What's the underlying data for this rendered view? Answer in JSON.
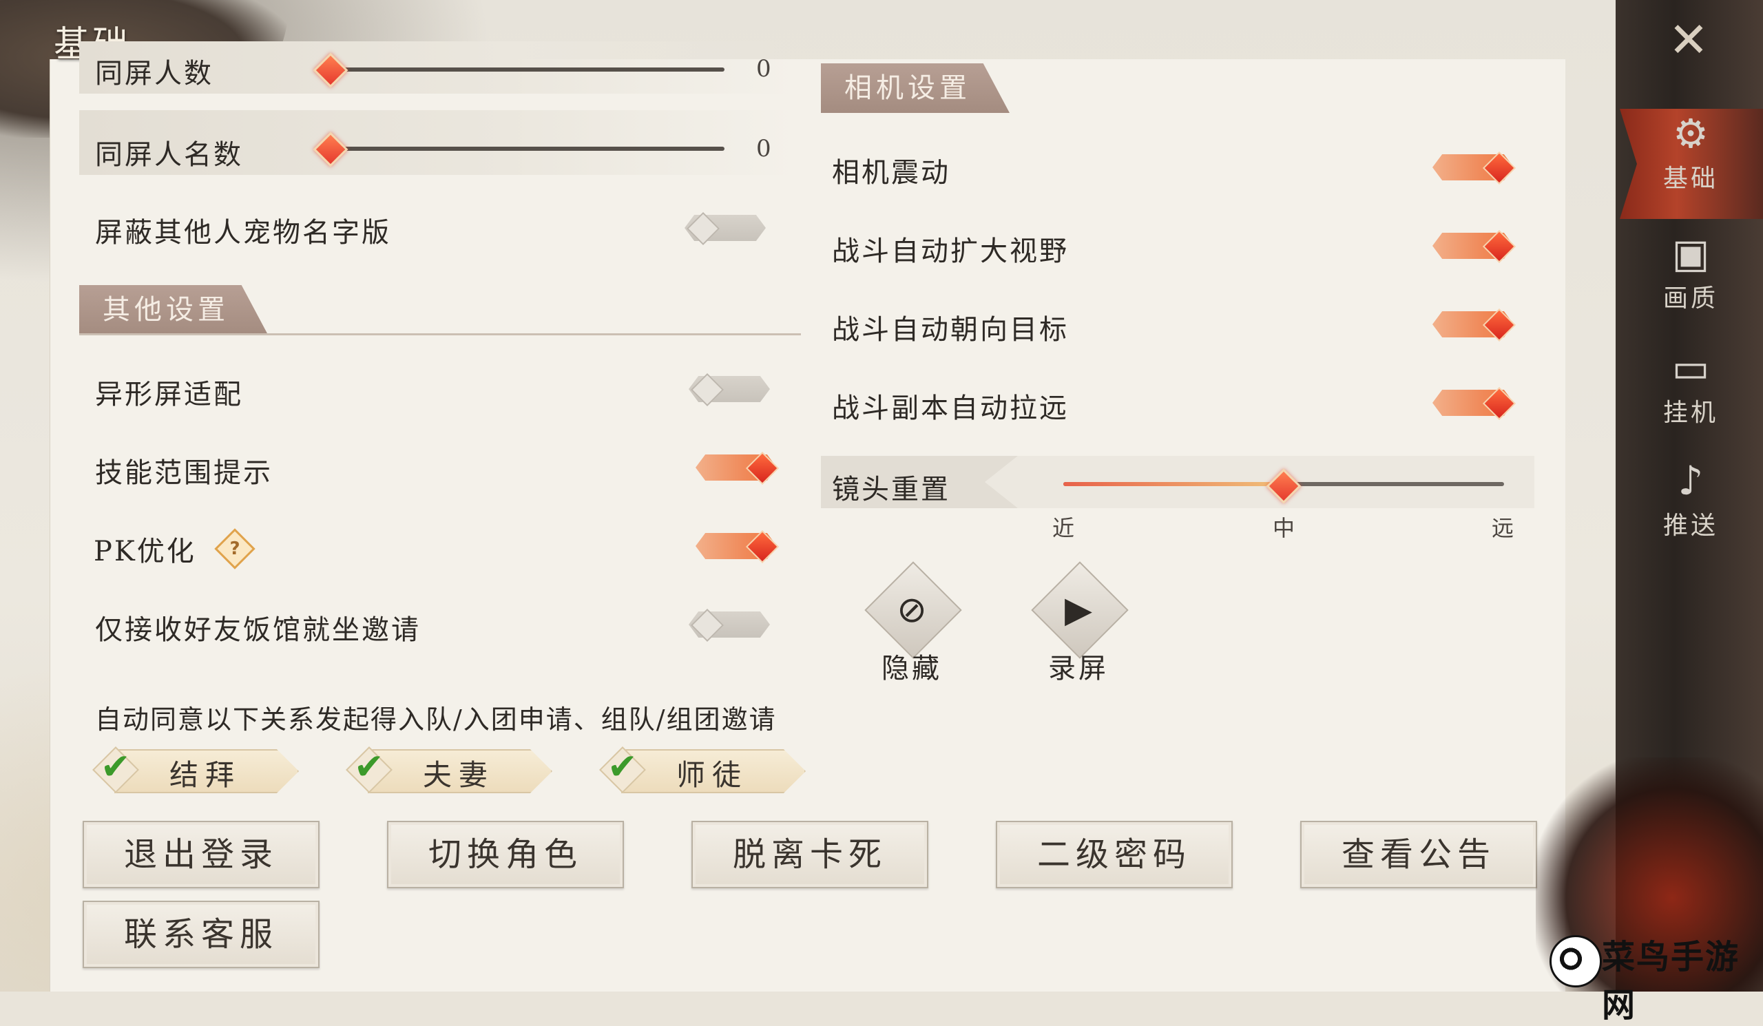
{
  "page_title": "基础",
  "left": {
    "rows_top": [
      {
        "label": "同屏人数",
        "value": "0"
      },
      {
        "label": "同屏人名数",
        "value": "0"
      }
    ],
    "pet_name_toggle": {
      "label": "屏蔽其他人宠物名字版",
      "state": "off"
    },
    "other_section_title": "其他设置",
    "other_rows": [
      {
        "label": "异形屏适配",
        "state": "off"
      },
      {
        "label": "技能范围提示",
        "state": "on"
      },
      {
        "label": "PK优化",
        "state": "on",
        "help": "?"
      },
      {
        "label": "仅接收好友饭馆就坐邀请",
        "state": "off"
      }
    ],
    "auto_agree_text": "自动同意以下关系发起得入队/入团申请、组队/组团邀请",
    "relations": [
      {
        "label": "结拜",
        "checked": true
      },
      {
        "label": "夫妻",
        "checked": true
      },
      {
        "label": "师徒",
        "checked": true
      }
    ]
  },
  "camera": {
    "section_title": "相机设置",
    "rows": [
      {
        "label": "相机震动",
        "state": "on"
      },
      {
        "label": "战斗自动扩大视野",
        "state": "on"
      },
      {
        "label": "战斗自动朝向目标",
        "state": "on"
      },
      {
        "label": "战斗副本自动拉远",
        "state": "on"
      }
    ],
    "reset_label": "镜头重置",
    "distance_ticks": [
      "近",
      "中",
      "远"
    ],
    "distance_value": 0.5,
    "actions": [
      {
        "label": "隐藏",
        "icon": "eye-slash-icon",
        "glyph": "⊘"
      },
      {
        "label": "录屏",
        "icon": "video-camera-icon",
        "glyph": "▶"
      }
    ]
  },
  "buttons": {
    "logout": "退出登录",
    "switch_role": "切换角色",
    "unstuck": "脱离卡死",
    "second_password": "二级密码",
    "notice": "查看公告",
    "contact_support": "联系客服"
  },
  "sidebar": {
    "close_glyph": "✕",
    "items": [
      {
        "label": "基础",
        "icon": "gear-icon",
        "glyph": "⚙",
        "active": true
      },
      {
        "label": "画质",
        "icon": "image-icon",
        "glyph": "▣",
        "active": false
      },
      {
        "label": "挂机",
        "icon": "monitor-icon",
        "glyph": "▭",
        "active": false
      },
      {
        "label": "推送",
        "icon": "bell-icon",
        "glyph": "♪",
        "active": false
      }
    ]
  },
  "watermark": "菜鸟手游网",
  "colors": {
    "accent": "#e63a2e",
    "toggle_on": "#f08a5a",
    "check": "#3c9a2a"
  }
}
